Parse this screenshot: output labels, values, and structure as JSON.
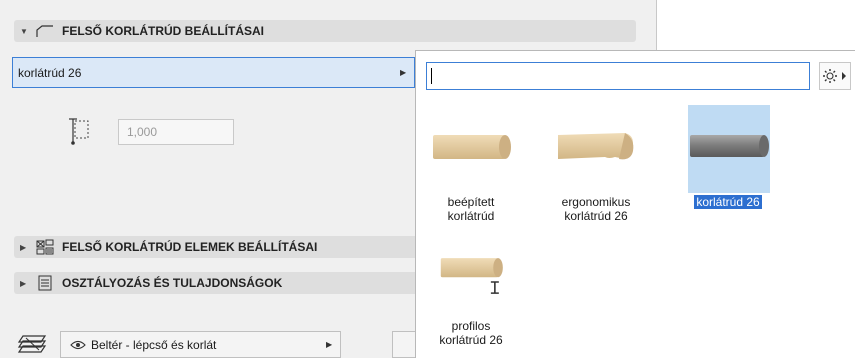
{
  "sections": {
    "top_rail": {
      "title": "FELSŐ KORLÁTRÚD BEÁLLÍTÁSAI",
      "expanded": true,
      "icon": "rail-profile-icon"
    },
    "elements": {
      "title": "FELSŐ KORLÁTRÚD ELEMEK BEÁLLÍTÁSAI",
      "expanded": false,
      "icon": "rail-elements-icon"
    },
    "classification": {
      "title": "OSZTÁLYOZÁS ÉS TULAJDONSÁGOK",
      "expanded": false,
      "icon": "properties-icon"
    }
  },
  "profile_selector": {
    "value": "korlátrúd 26"
  },
  "offset_field": {
    "value": "1,000"
  },
  "layer_selector": {
    "value": "Beltér - lépcső és korlát",
    "icon": "eye-icon"
  },
  "popup": {
    "search": {
      "value": ""
    },
    "settings_icon": "gear-icon",
    "items": [
      {
        "line1": "beépített",
        "line2": "korlátrúd",
        "selected": false,
        "profile": "round-wood"
      },
      {
        "line1": "ergonomikus",
        "line2": "korlátrúd 26",
        "selected": false,
        "profile": "ergonomic-wood"
      },
      {
        "line1": "korlátrúd 26",
        "line2": "",
        "selected": true,
        "profile": "steel-tube"
      },
      {
        "line1": "profilos",
        "line2": "korlátrúd 26",
        "selected": false,
        "profile": "custom-wood"
      }
    ]
  },
  "colors": {
    "accent": "#3c7fd6",
    "selection": "#2d6fd0",
    "wood": "#e6cfa6",
    "steel": "#8a8a8a"
  }
}
